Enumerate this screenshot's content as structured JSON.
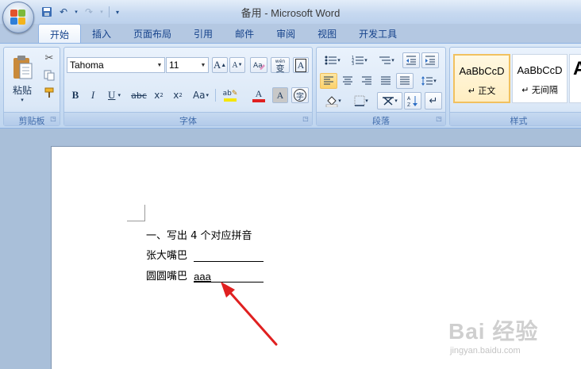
{
  "window": {
    "title": "备用 - Microsoft Word"
  },
  "tabs": [
    {
      "label": "开始",
      "active": true
    },
    {
      "label": "插入"
    },
    {
      "label": "页面布局"
    },
    {
      "label": "引用"
    },
    {
      "label": "邮件"
    },
    {
      "label": "审阅"
    },
    {
      "label": "视图"
    },
    {
      "label": "开发工具"
    }
  ],
  "clipboard": {
    "paste_label": "粘贴",
    "group_label": "剪贴板"
  },
  "font": {
    "name": "Tahoma",
    "size": "11",
    "group_label": "字体",
    "phonetic_glyph": "wén",
    "phonetic_char": "变"
  },
  "paragraph": {
    "group_label": "段落"
  },
  "styles": {
    "group_label": "样式",
    "items": [
      {
        "sample": "AaBbCcD",
        "name": "↵ 正文"
      },
      {
        "sample": "AaBbCcD",
        "name": "↵ 无间隔"
      },
      {
        "sample": "A",
        "name": ""
      }
    ]
  },
  "document": {
    "lines": [
      {
        "text": "一、写出 4 个对应拼音"
      },
      {
        "label": "张大嘴巴",
        "answer": ""
      },
      {
        "label": "圆圆嘴巴",
        "answer": "aaa"
      }
    ]
  },
  "watermark": {
    "main": "Bai 经验",
    "sub": "jingyan.baidu.com"
  },
  "colors": {
    "highlight": "#f5e600",
    "font_color": "#e02020",
    "arrow": "#e02020"
  }
}
